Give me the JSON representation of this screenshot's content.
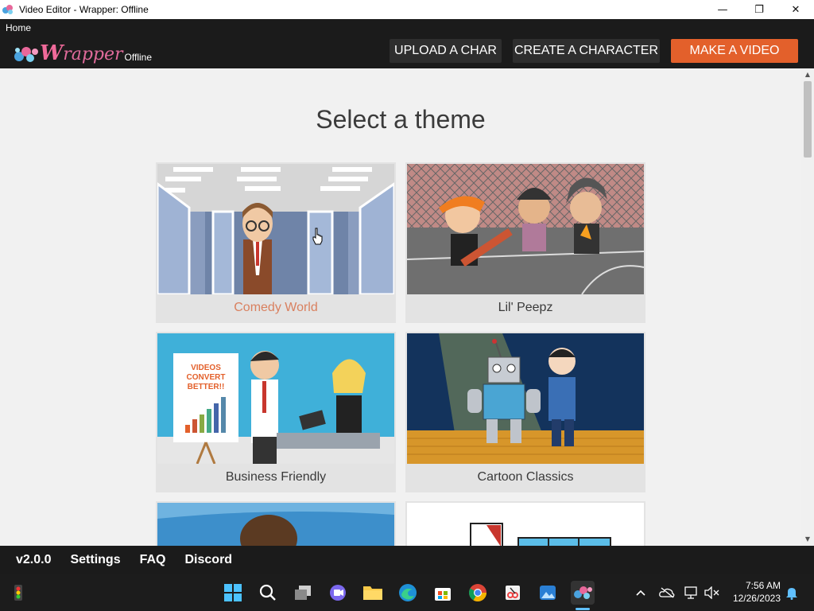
{
  "window": {
    "title": "Video Editor - Wrapper: Offline",
    "minimize": "—",
    "maximize": "❐",
    "close": "✕"
  },
  "menubar": {
    "home": "Home"
  },
  "header": {
    "logo_w": "W",
    "logo_rapper": "rapper",
    "logo_offline": "Offline",
    "upload_char": "UPLOAD A CHAR",
    "create_character": "CREATE A CHARACTER",
    "make_video": "MAKE A VIDEO"
  },
  "main": {
    "heading": "Select a theme",
    "themes": [
      {
        "label": "Comedy World"
      },
      {
        "label": "Lil' Peepz"
      },
      {
        "label": "Business Friendly"
      },
      {
        "label": "Cartoon Classics"
      }
    ],
    "business_poster_lines": [
      "VIDEOS",
      "CONVERT",
      "BETTER!!"
    ]
  },
  "footer": {
    "version": "v2.0.0",
    "settings": "Settings",
    "faq": "FAQ",
    "discord": "Discord"
  },
  "taskbar": {
    "time": "7:56 AM",
    "date": "12/26/2023"
  },
  "colors": {
    "accent": "#e3602b",
    "dark": "#1b1b1b",
    "active_label": "#d9805f"
  }
}
